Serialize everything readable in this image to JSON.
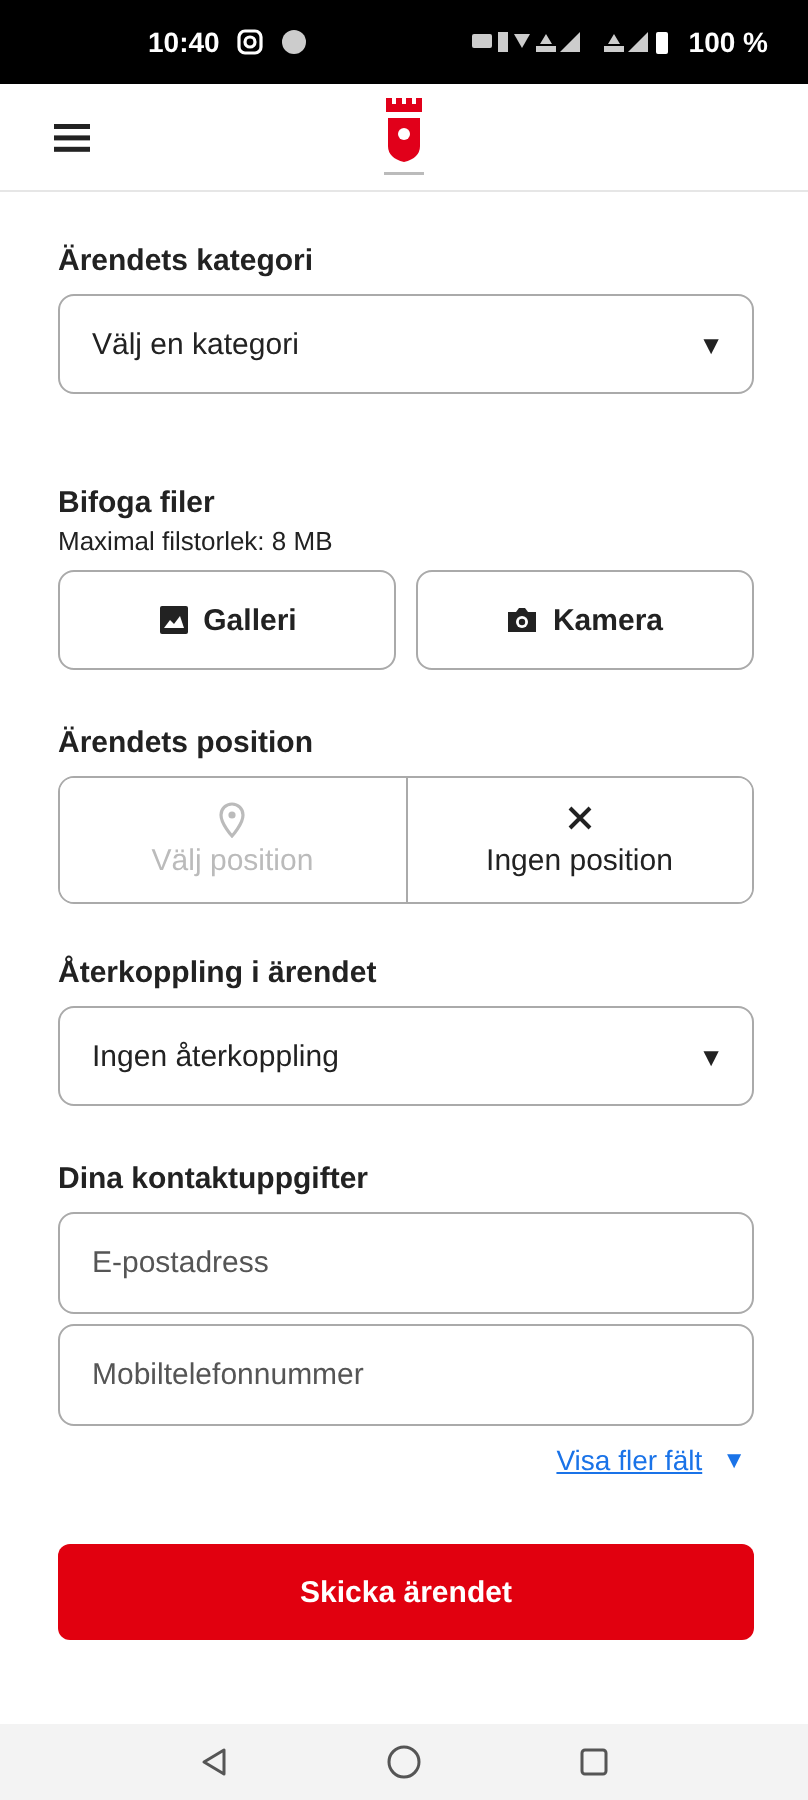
{
  "status_bar": {
    "time": "10:40",
    "battery": "100 %"
  },
  "category": {
    "label": "Ärendets kategori",
    "value": "Välj en kategori",
    "arrow": "▼"
  },
  "attachments": {
    "label": "Bifoga filer",
    "hint": "Maximal filstorlek: 8 MB",
    "buttons": [
      {
        "kind": "gallery",
        "label": "Galleri"
      },
      {
        "kind": "camera",
        "label": "Kamera"
      }
    ]
  },
  "position": {
    "label": "Ärendets position",
    "options": [
      {
        "kind": "pin",
        "label": "Välj position",
        "disabled": true
      },
      {
        "kind": "none",
        "label": "Ingen position",
        "disabled": false
      }
    ]
  },
  "feedback": {
    "label": "Återkoppling i ärendet",
    "value": "Ingen återkoppling",
    "arrow": "▼"
  },
  "contact": {
    "label": "Dina kontaktuppgifter",
    "fields": [
      {
        "placeholder": "E-postadress"
      },
      {
        "placeholder": "Mobiltelefonnummer"
      }
    ],
    "more_link": "Visa fler fält",
    "more_arrow": "▼"
  },
  "submit": "Skicka ärendet"
}
